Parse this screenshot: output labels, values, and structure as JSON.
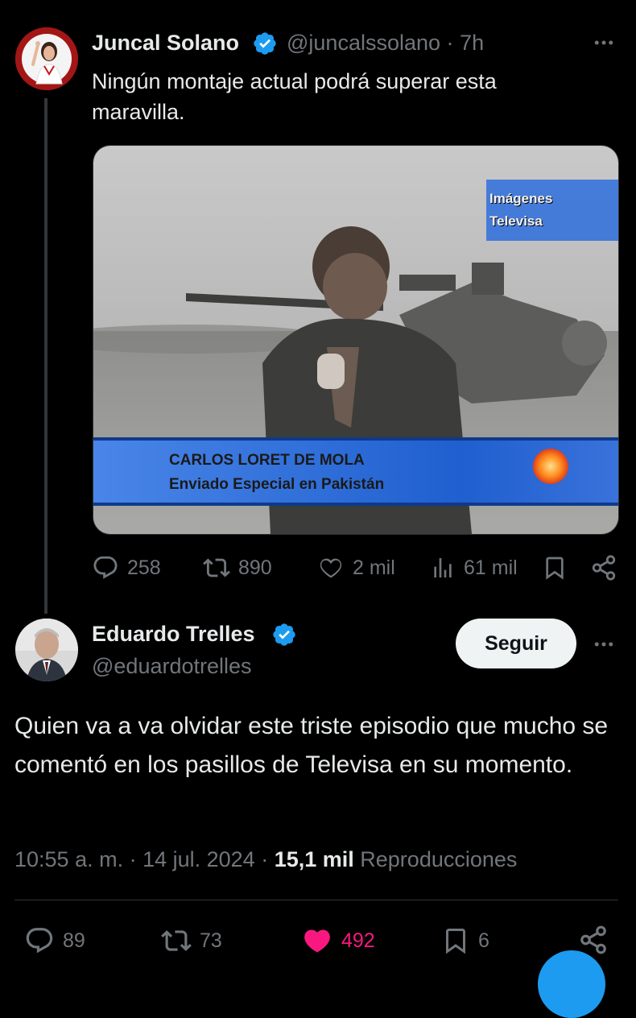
{
  "colors": {
    "accent": "#1d9bf0",
    "like": "#f91880",
    "muted": "#71767b",
    "text": "#e7e9ea"
  },
  "original_tweet": {
    "author_name": "Juncal Solano",
    "handle": "@juncalssolano",
    "separator": "·",
    "time": "7h",
    "text": "Ningún montaje actual podrá superar esta maravilla.",
    "more_icon": "more-icon",
    "media": {
      "watermark_line1": "Imágenes",
      "watermark_line2": "Televisa",
      "caption_name": "CARLOS LORET DE MOLA",
      "caption_role": "Enviado Especial en Pakistán"
    },
    "actions": {
      "replies": "258",
      "retweets": "890",
      "likes": "2 mil",
      "views": "61 mil"
    }
  },
  "reply_tweet": {
    "author_name": "Eduardo Trelles",
    "handle": "@eduardotrelles",
    "follow_label": "Seguir",
    "text": "Quien va a va olvidar este triste episodio que mucho se comentó en los pasillos de Televisa en su momento.",
    "timestamp": "10:55 a. m. · 14 jul. 2024 ·",
    "views_count": "15,1 mil",
    "views_label": "Reproducciones",
    "actions": {
      "replies": "89",
      "retweets": "73",
      "likes": "492",
      "bookmarks": "6"
    }
  }
}
